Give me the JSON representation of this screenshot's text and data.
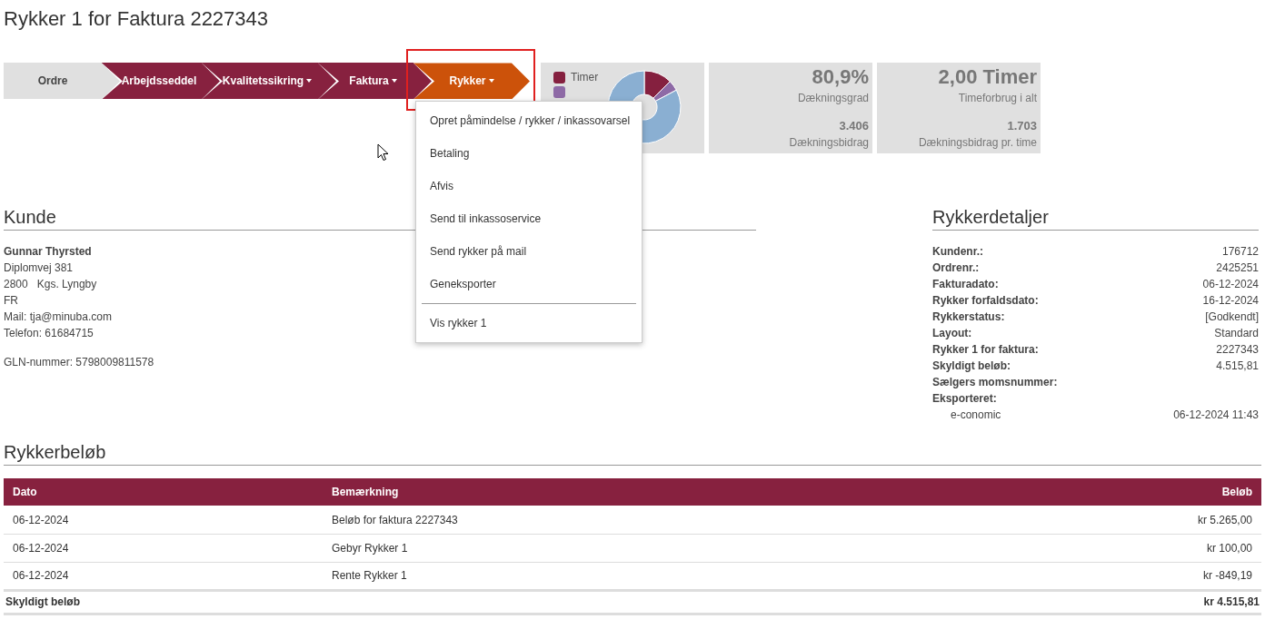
{
  "page_title": "Rykker 1 for Faktura 2227343",
  "steps": [
    {
      "label": "Ordre",
      "completed": false,
      "selected": false,
      "dropdown": false
    },
    {
      "label": "Arbejdsseddel",
      "completed": true,
      "selected": false,
      "dropdown": false
    },
    {
      "label": "Kvalitetssikring",
      "completed": true,
      "selected": false,
      "dropdown": true
    },
    {
      "label": "Faktura",
      "completed": true,
      "selected": false,
      "dropdown": true
    },
    {
      "label": "Rykker",
      "selected": true,
      "dropdown": true,
      "highlighted": true
    }
  ],
  "dropdown_menu": [
    {
      "kind": "action",
      "label": "Opret påmindelse / rykker / inkassovarsel"
    },
    {
      "kind": "action",
      "label": "Betaling"
    },
    {
      "kind": "action",
      "label": "Afvis"
    },
    {
      "kind": "action",
      "label": "Send til inkassoservice"
    },
    {
      "kind": "action",
      "label": "Send rykker på mail"
    },
    {
      "kind": "action",
      "label": "Geneksporter"
    },
    {
      "kind": "divider"
    },
    {
      "kind": "action",
      "label": "Vis rykker 1"
    }
  ],
  "chart_legend": [
    {
      "label": "Timer",
      "color": "#85203f"
    },
    {
      "color": "#8e6aa6"
    }
  ],
  "kpis": [
    {
      "value": "80,9%",
      "label": "Dækningsgrad",
      "sub_value": "3.406",
      "sub_label": "Dækningsbidrag"
    },
    {
      "value": "2,00 Timer",
      "label": "Timeforbrug i alt",
      "sub_value": "1.703",
      "sub_label": "Dækningsbidrag pr. time"
    }
  ],
  "customer": {
    "heading": "Kunde",
    "name": "Gunnar Thyrsted",
    "lines": [
      "Diplomvej 381",
      "2800   Kgs. Lyngby",
      "FR",
      "Mail: tja@minuba.com",
      "Telefon: 61684715"
    ],
    "gln": "GLN-nummer: 5798009811578"
  },
  "details": {
    "heading": "Rykkerdetaljer",
    "rows": [
      {
        "label": "Kundenr.:",
        "value": "176712"
      },
      {
        "label": "Ordrenr.:",
        "value": "2425251"
      },
      {
        "label": "Fakturadato:",
        "value": "06-12-2024"
      },
      {
        "label": "Rykker forfaldsdato:",
        "value": "16-12-2024"
      },
      {
        "label": "Rykkerstatus:",
        "value": "[Godkendt]"
      },
      {
        "label": "Layout:",
        "value": "Standard"
      },
      {
        "label": "Rykker 1 for faktura:",
        "value": "2227343"
      },
      {
        "label": "Skyldigt beløb:",
        "value": "4.515,81"
      },
      {
        "label": "Sælgers momsnummer:"
      },
      {
        "label": "Eksporteret:",
        "children": [
          {
            "label": "e-conomic",
            "value": "06-12-2024 11:43"
          }
        ]
      }
    ]
  },
  "amounts": {
    "heading": "Rykkerbeløb",
    "columns": [
      "Dato",
      "Bemærkning",
      "Beløb"
    ],
    "rows": [
      [
        "06-12-2024",
        "Beløb for faktura 2227343",
        "kr 5.265,00"
      ],
      [
        "06-12-2024",
        "Gebyr Rykker 1",
        "kr 100,00"
      ],
      [
        "06-12-2024",
        "Rente Rykker 1",
        "kr -849,19"
      ]
    ],
    "total": {
      "label": "Skyldigt beløb",
      "value": "kr 4.515,81"
    }
  }
}
